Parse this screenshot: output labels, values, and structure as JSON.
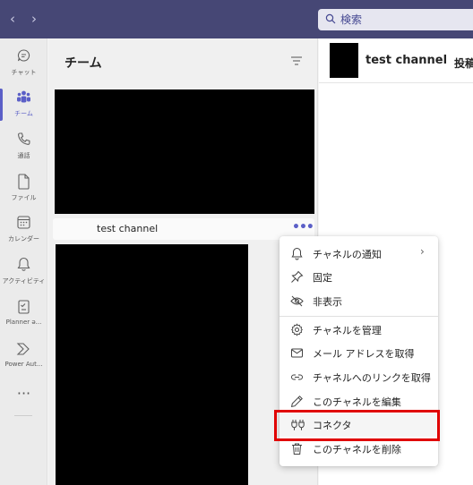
{
  "topbar": {
    "back_icon": "chevron-left-icon",
    "forward_icon": "chevron-right-icon",
    "search_placeholder": "検索"
  },
  "rail": {
    "items": [
      {
        "label": "チャット",
        "icon": "chat-icon",
        "active": false
      },
      {
        "label": "チーム",
        "icon": "teams-icon",
        "active": true
      },
      {
        "label": "通話",
        "icon": "phone-icon",
        "active": false
      },
      {
        "label": "ファイル",
        "icon": "file-icon",
        "active": false
      },
      {
        "label": "カレンダー",
        "icon": "calendar-icon",
        "active": false
      },
      {
        "label": "アクティビティ",
        "icon": "bell-icon",
        "active": false
      },
      {
        "label": "Planner ə...",
        "icon": "planner-icon",
        "active": false
      },
      {
        "label": "Power Aut...",
        "icon": "power-automate-icon",
        "active": false
      }
    ],
    "more_label": "···"
  },
  "panel": {
    "title": "チーム",
    "channel_name": "test channel",
    "channel_more": "•••"
  },
  "main": {
    "channel_title": "test channel",
    "tab_label": "投稿"
  },
  "menu": {
    "items": [
      {
        "label": "チャネルの通知",
        "icon": "bell-icon",
        "has_submenu": true
      },
      {
        "label": "固定",
        "icon": "pin-icon"
      },
      {
        "label": "非表示",
        "icon": "eye-off-icon"
      },
      {
        "label": "チャネルを管理",
        "icon": "gear-icon"
      },
      {
        "label": "メール アドレスを取得",
        "icon": "mail-icon"
      },
      {
        "label": "チャネルへのリンクを取得",
        "icon": "link-icon"
      },
      {
        "label": "このチャネルを編集",
        "icon": "pencil-icon"
      },
      {
        "label": "コネクタ",
        "icon": "connector-icon",
        "highlighted": true
      },
      {
        "label": "このチャネルを削除",
        "icon": "trash-icon"
      }
    ],
    "chevron": "›"
  },
  "colors": {
    "topbar": "#464775",
    "accent": "#5b5fc7",
    "highlight_box": "#e00000"
  }
}
